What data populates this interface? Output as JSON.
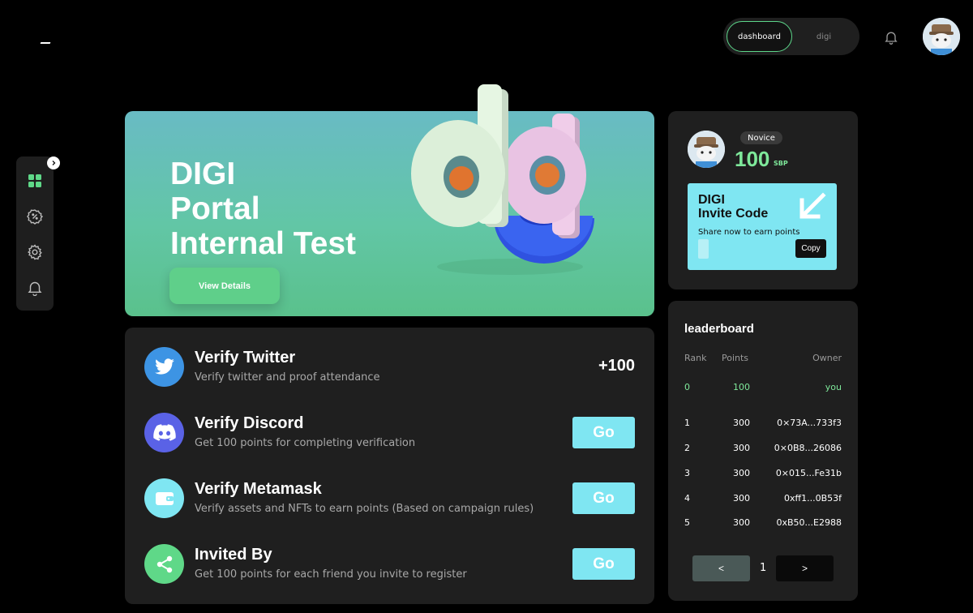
{
  "nav": {
    "tabs": [
      {
        "label": "dashboard",
        "active": true
      },
      {
        "label": "digi",
        "active": false
      }
    ]
  },
  "sidebar": {
    "items": [
      {
        "icon": "grid-icon",
        "active": true
      },
      {
        "icon": "badge-icon",
        "active": false
      },
      {
        "icon": "gear-icon",
        "active": false
      },
      {
        "icon": "bell-icon",
        "active": false
      }
    ]
  },
  "hero": {
    "title_lines": [
      "DIGI",
      "Portal",
      "Internal Test"
    ],
    "button_label": "View Details"
  },
  "tasks": [
    {
      "title": "Verify Twitter",
      "description": "Verify twitter and proof attendance",
      "reward": "+100",
      "icon": "twitter-icon"
    },
    {
      "title": "Verify Discord",
      "description": "Get 100 points for completing verification",
      "action": "Go",
      "icon": "discord-icon"
    },
    {
      "title": "Verify Metamask",
      "description": "Verify assets and NFTs to earn points (Based on campaign rules)",
      "action": "Go",
      "icon": "wallet-icon"
    },
    {
      "title": "Invited By",
      "description": "Get 100 points for each friend you invite to register",
      "action": "Go",
      "icon": "share-icon"
    }
  ],
  "profile": {
    "rank": "Novice",
    "points": "100",
    "unit": "SBP",
    "invite": {
      "title_lines": [
        "DIGI",
        "Invite Code"
      ],
      "hint": "Share now to earn points",
      "copy_label": "Copy"
    }
  },
  "leaderboard": {
    "title": "leaderboard",
    "columns": {
      "rank": "Rank",
      "points": "Points",
      "owner": "Owner"
    },
    "me": {
      "rank": "0",
      "points": "100",
      "owner": "you"
    },
    "rows": [
      {
        "rank": "1",
        "points": "300",
        "owner": "0×73A...733f3"
      },
      {
        "rank": "2",
        "points": "300",
        "owner": "0×0B8...26086"
      },
      {
        "rank": "3",
        "points": "300",
        "owner": "0×015...Fe31b"
      },
      {
        "rank": "4",
        "points": "300",
        "owner": "0xff1...0B53f"
      },
      {
        "rank": "5",
        "points": "300",
        "owner": "0xB50...E2988"
      }
    ],
    "pager": {
      "prev": "<",
      "page": "1",
      "next": ">"
    }
  },
  "colors": {
    "accent_green": "#7ee89a",
    "cyan": "#7fe6f2",
    "panel": "#1f1f1f"
  }
}
